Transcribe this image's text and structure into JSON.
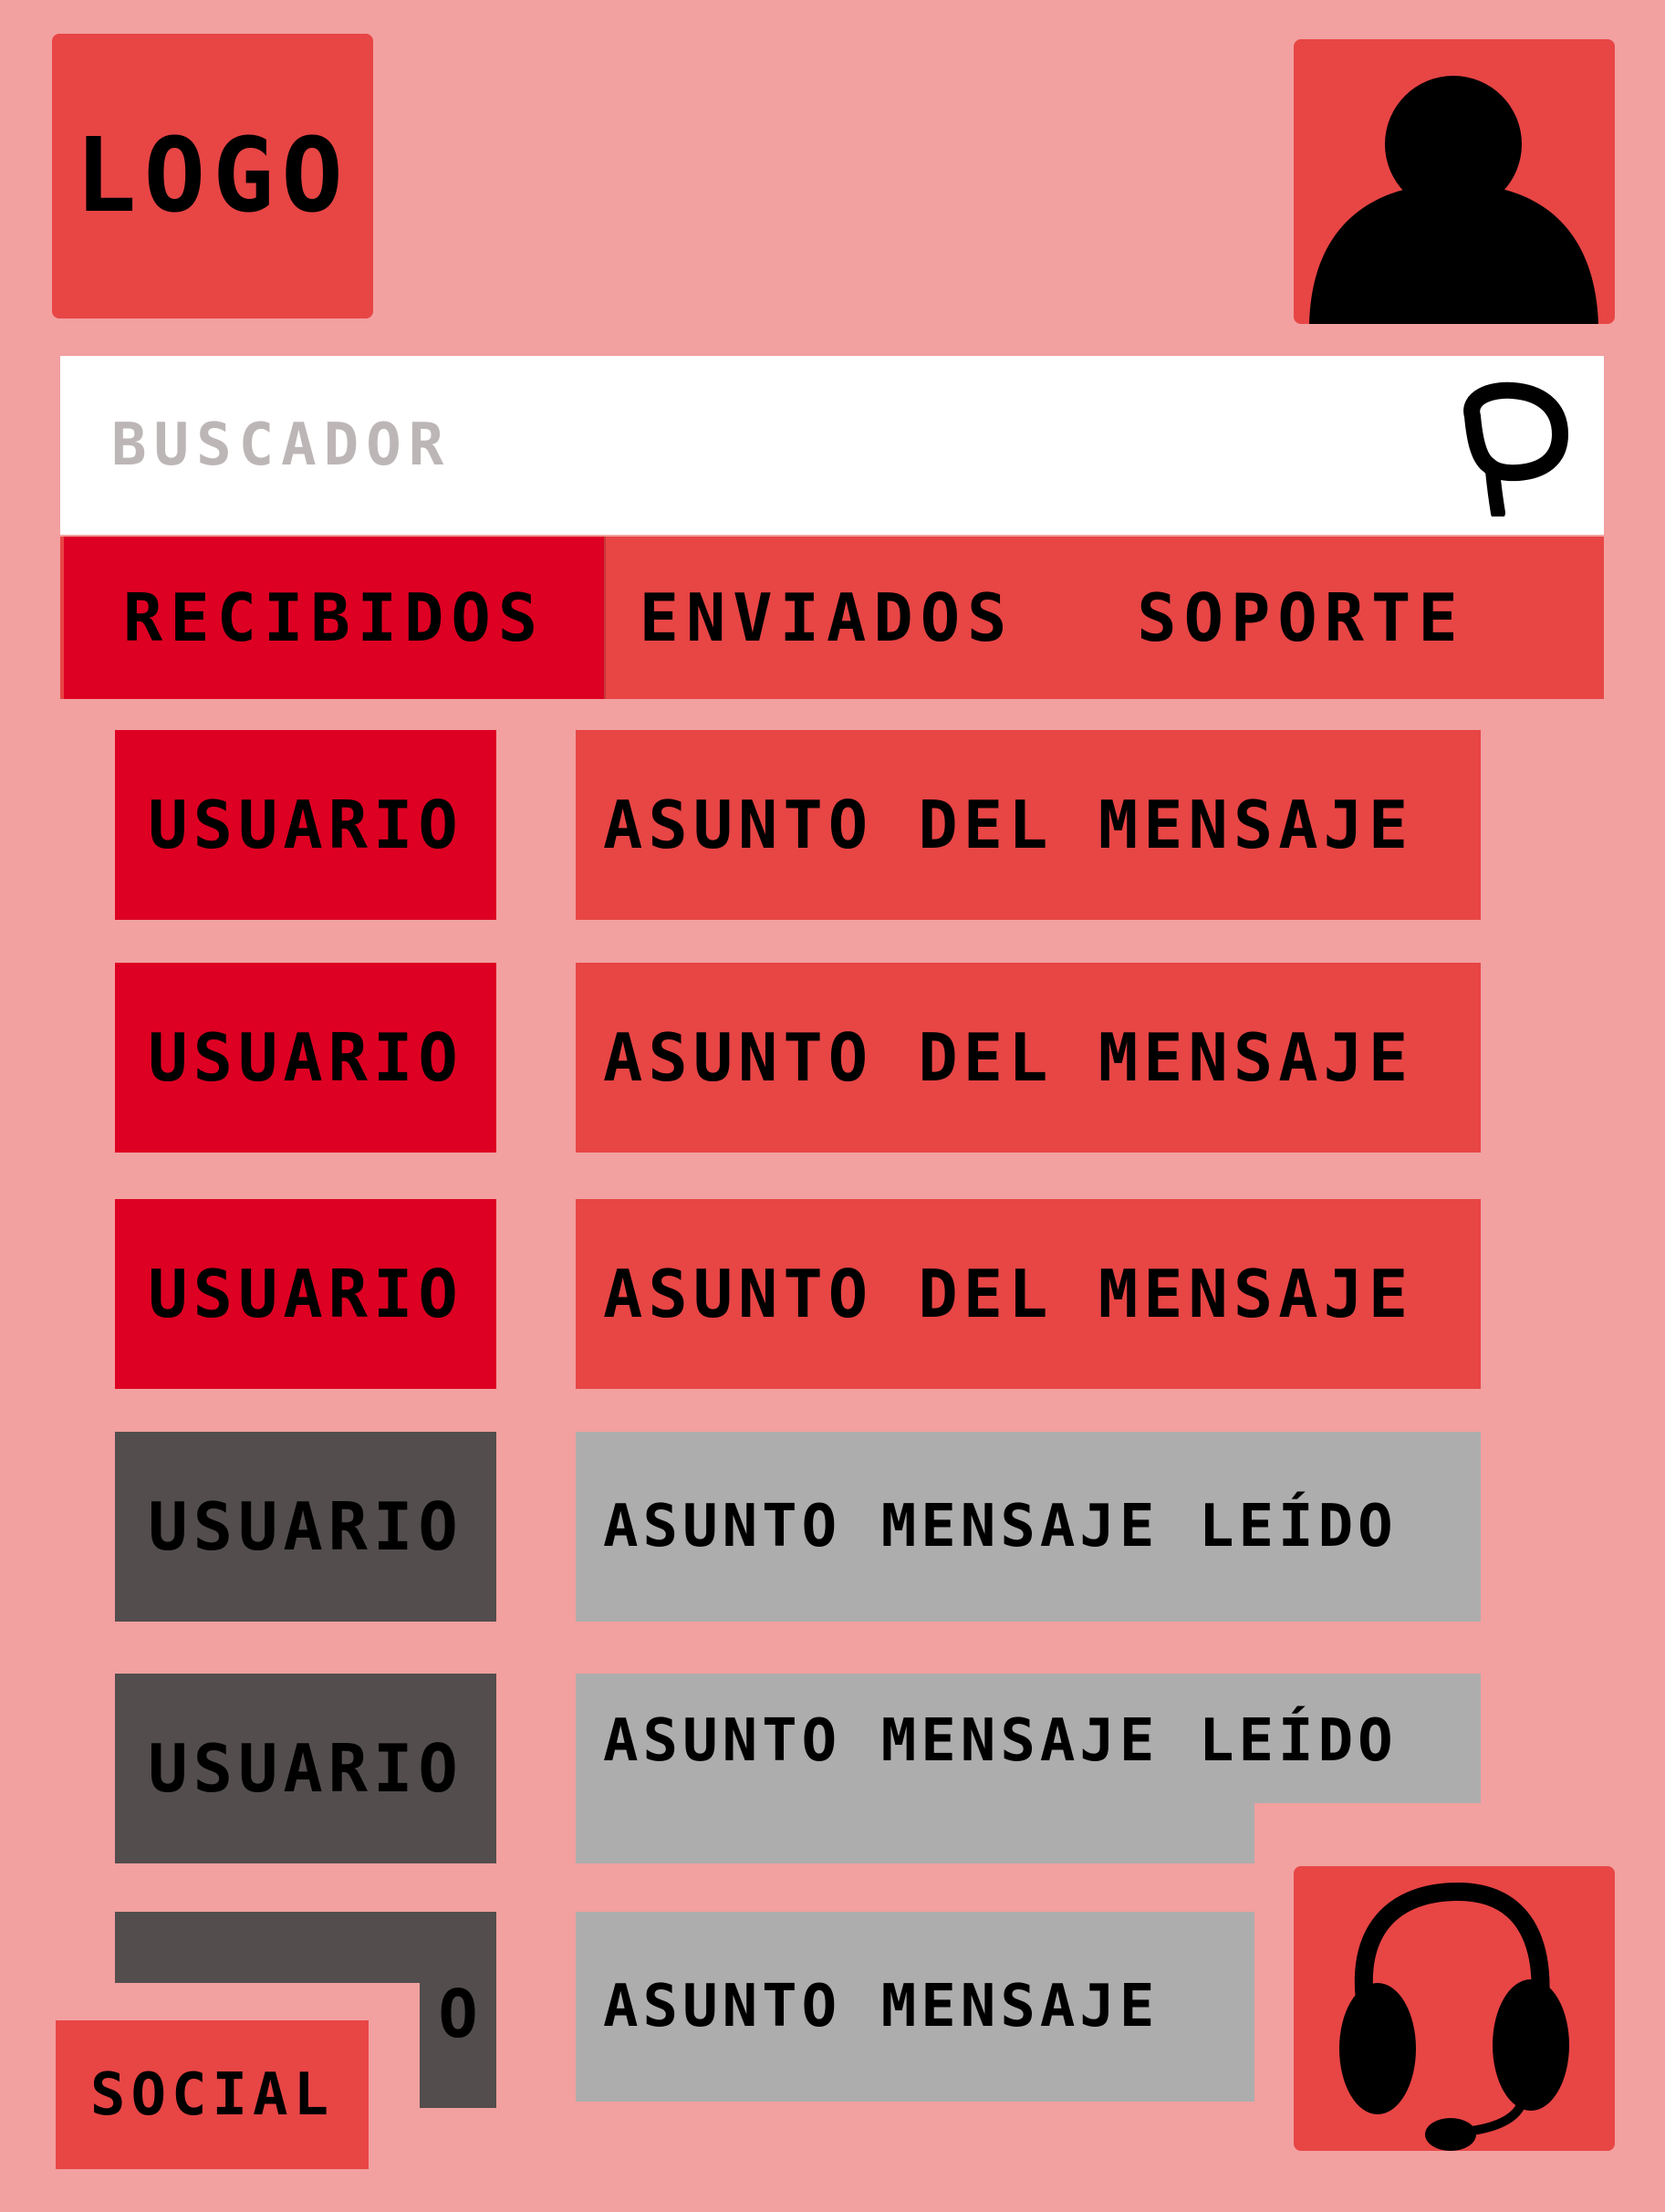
{
  "header": {
    "logo_text": "LOGO",
    "avatar_icon": "user-silhouette-icon"
  },
  "search": {
    "placeholder": "BUSCADOR",
    "icon": "search-icon"
  },
  "tabs": [
    {
      "label": "RECIBIDOS",
      "active": true
    },
    {
      "label": "ENVIADOS",
      "active": false
    },
    {
      "label": "SOPORTE",
      "active": false
    }
  ],
  "messages": [
    {
      "user": "USUARIO",
      "subject": "ASUNTO DEL MENSAJE",
      "read": false
    },
    {
      "user": "USUARIO",
      "subject": "ASUNTO DEL MENSAJE",
      "read": false
    },
    {
      "user": "USUARIO",
      "subject": "ASUNTO DEL MENSAJE",
      "read": false
    },
    {
      "user": "USUARIO",
      "subject": "ASUNTO MENSAJE LEÍDO",
      "read": true
    },
    {
      "user": "USUARIO",
      "subject": "ASUNTO MENSAJE LEÍDO",
      "read": true
    },
    {
      "user": "O",
      "subject": "ASUNTO MENSAJE",
      "read": true
    }
  ],
  "footer": {
    "social_label": "SOCIAL",
    "support_icon": "headset-icon"
  },
  "colors": {
    "background": "#f2a0a0",
    "accent": "#e84545",
    "unread": "#dd0022",
    "read_user": "#534d4d",
    "read_subject": "#adadad"
  }
}
